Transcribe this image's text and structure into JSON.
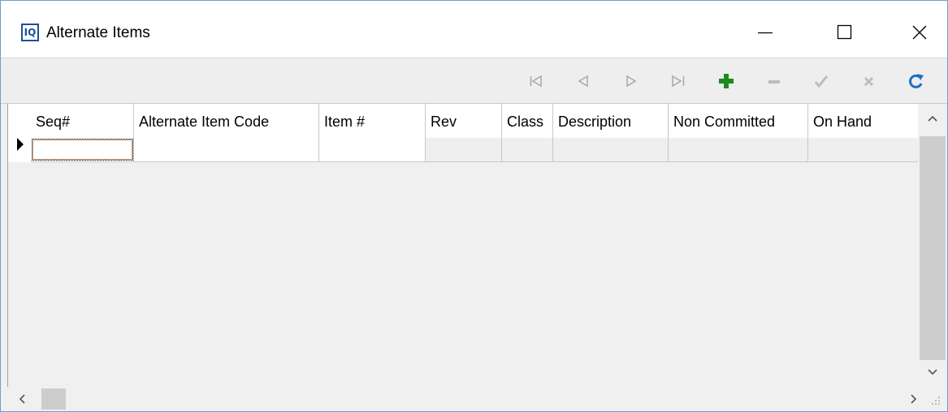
{
  "window": {
    "title": "Alternate Items",
    "app_icon_text": "IQ"
  },
  "title_buttons": {
    "minimize": "minimize-icon",
    "maximize": "maximize-icon",
    "close": "close-icon"
  },
  "toolbar": {
    "icons": [
      "first-record-icon",
      "prior-record-icon",
      "next-record-icon",
      "last-record-icon",
      "insert-record-icon",
      "delete-record-icon",
      "post-edit-icon",
      "cancel-edit-icon",
      "refresh-icon"
    ],
    "insert_color": "#1e8a1e",
    "refresh_color": "#1a6fc4",
    "disabled_color": "#a8a8a8"
  },
  "grid": {
    "columns": [
      "Seq#",
      "Alternate Item Code",
      "Item #",
      "Rev",
      "Class",
      "Description",
      "Non Committed",
      "On Hand"
    ],
    "rows": [
      [
        "",
        "",
        "",
        "",
        "",
        "",
        "",
        ""
      ]
    ]
  }
}
